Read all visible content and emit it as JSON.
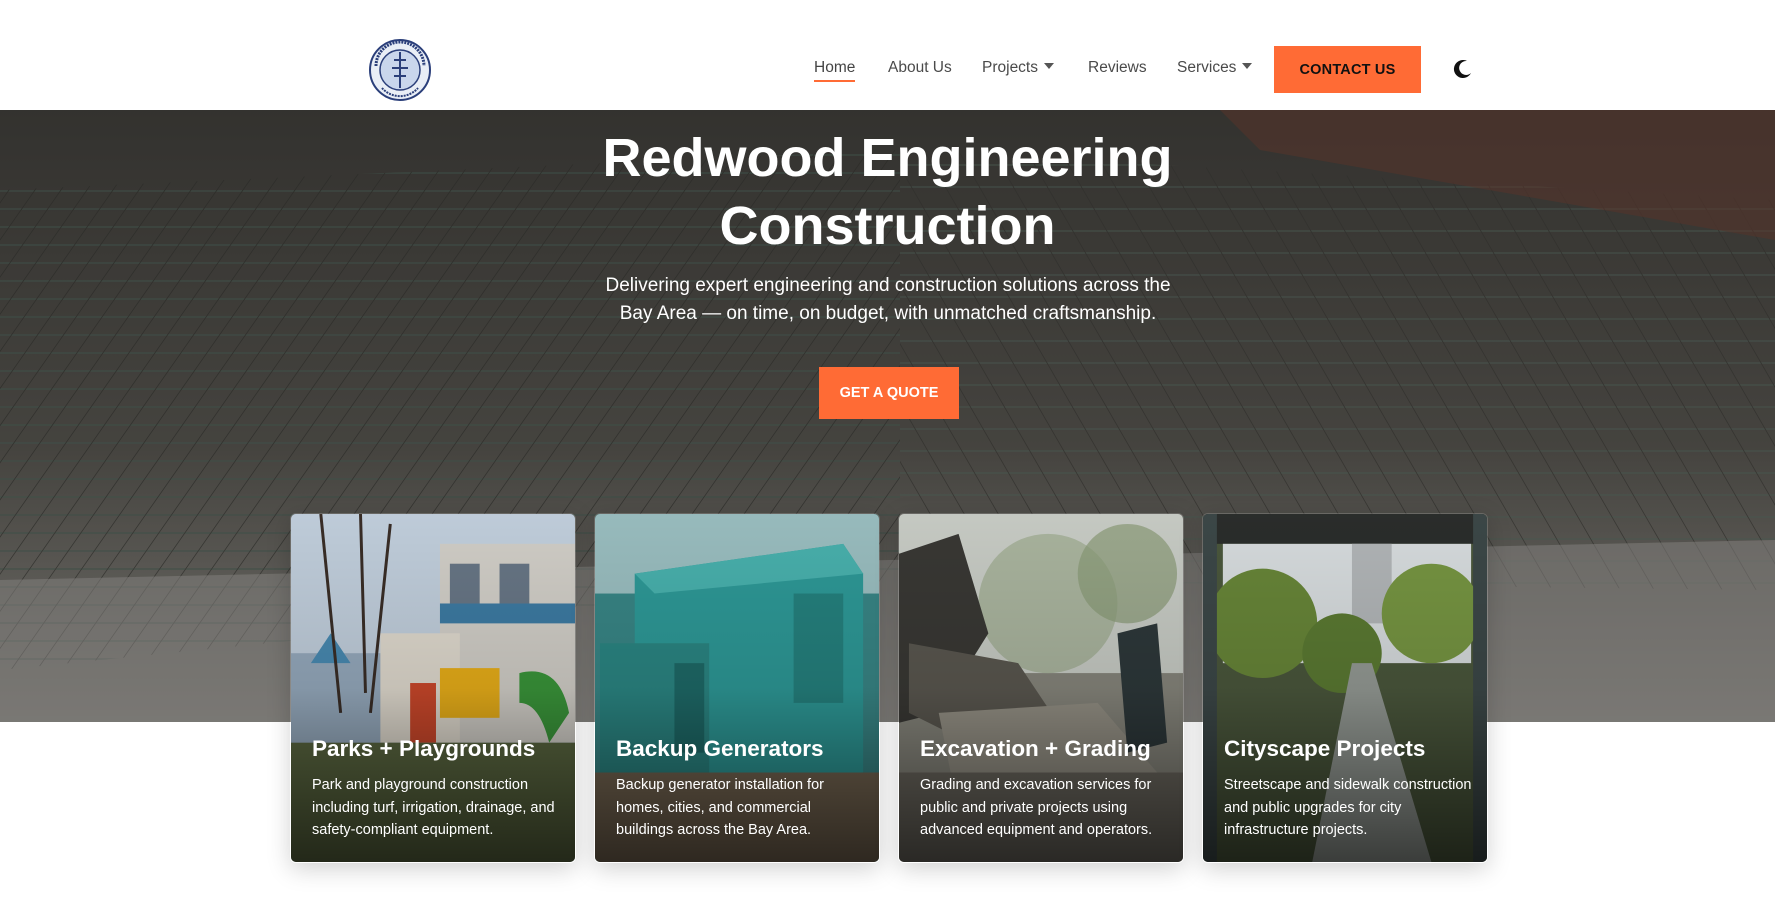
{
  "header": {
    "logo": {
      "alt": "Redwood Engineering Construction",
      "icon": "company-logo"
    },
    "nav": [
      {
        "label": "Home",
        "active": true
      },
      {
        "label": "About Us"
      },
      {
        "label": "Projects",
        "dropdown": true
      },
      {
        "label": "Reviews"
      },
      {
        "label": "Services",
        "dropdown": true
      }
    ],
    "contact_label": "CONTACT US",
    "theme_toggle_icon": "moon-icon"
  },
  "hero": {
    "title_line1": "Redwood Engineering",
    "title_line2": "Construction",
    "subtitle": "Delivering expert engineering and construction solutions across the Bay Area — on time, on budget, with unmatched craftsmanship.",
    "cta_label": "GET A QUOTE"
  },
  "cards": [
    {
      "title": "Parks + Playgrounds",
      "text": "Park and playground construction including turf, irrigation, drainage, and safety-compliant equipment."
    },
    {
      "title": "Backup Generators",
      "text": "Backup generator installation for homes, cities, and commercial buildings across the Bay Area."
    },
    {
      "title": "Excavation + Grading",
      "text": "Grading and excavation services for public and private projects using advanced equipment and operators."
    },
    {
      "title": "Cityscape Projects",
      "text": "Streetscape and sidewalk construction and public upgrades for city infrastructure projects."
    }
  ],
  "colors": {
    "accent": "#ff6b35",
    "nav_text": "#4a4a4a",
    "white": "#ffffff"
  }
}
